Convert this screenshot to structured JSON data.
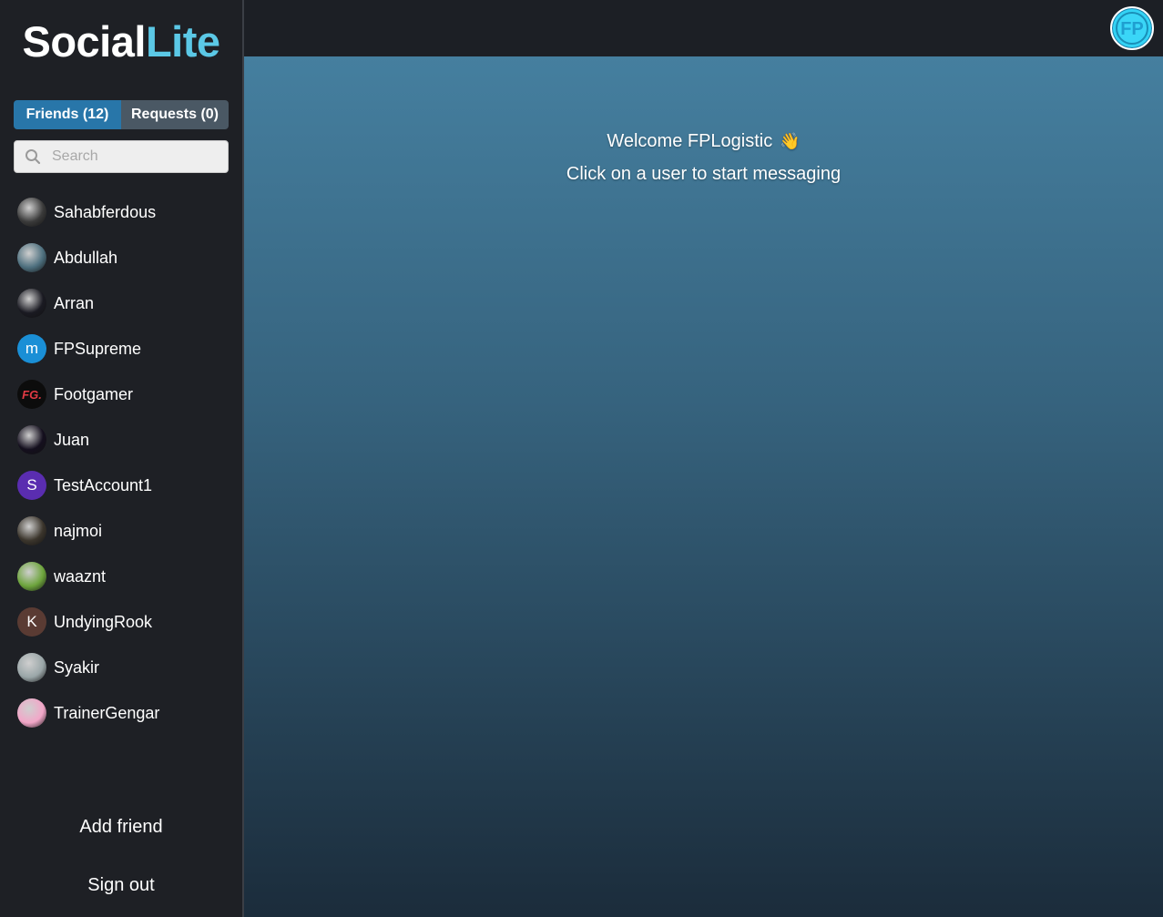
{
  "logo": {
    "part1": "Social",
    "part2": "Lite"
  },
  "tabs": {
    "friends_label": "Friends (12)",
    "requests_label": "Requests (0)"
  },
  "search": {
    "placeholder": "Search",
    "value": ""
  },
  "friends": [
    {
      "name": "Sahabferdous",
      "avatar": "photo",
      "color": "#3a3a3a"
    },
    {
      "name": "Abdullah",
      "avatar": "photo",
      "color": "#4d6f7e"
    },
    {
      "name": "Arran",
      "avatar": "photo",
      "color": "#1a1a22"
    },
    {
      "name": "FPSupreme",
      "avatar": "m",
      "color": "#1a8fd6"
    },
    {
      "name": "Footgamer",
      "avatar": "FG.",
      "color": "#0c0c0c"
    },
    {
      "name": "Juan",
      "avatar": "photo",
      "color": "#140f1e"
    },
    {
      "name": "TestAccount1",
      "avatar": "S",
      "color": "#5a2db0"
    },
    {
      "name": "najmoi",
      "avatar": "photo",
      "color": "#3b352c"
    },
    {
      "name": "waaznt",
      "avatar": "photo",
      "color": "#6da43c"
    },
    {
      "name": "UndyingRook",
      "avatar": "K",
      "color": "#5a3b33"
    },
    {
      "name": "Syakir",
      "avatar": "photo",
      "color": "#9aa6a8"
    },
    {
      "name": "TrainerGengar",
      "avatar": "photo",
      "color": "#f2a6c8"
    }
  ],
  "actions": {
    "add_friend": "Add friend",
    "sign_out": "Sign out"
  },
  "main": {
    "welcome": "Welcome FPLogistic",
    "wave_icon": "👋",
    "subtext": "Click on a user to start messaging"
  },
  "profile": {
    "initials": "FP",
    "color": "#33d3f5"
  }
}
